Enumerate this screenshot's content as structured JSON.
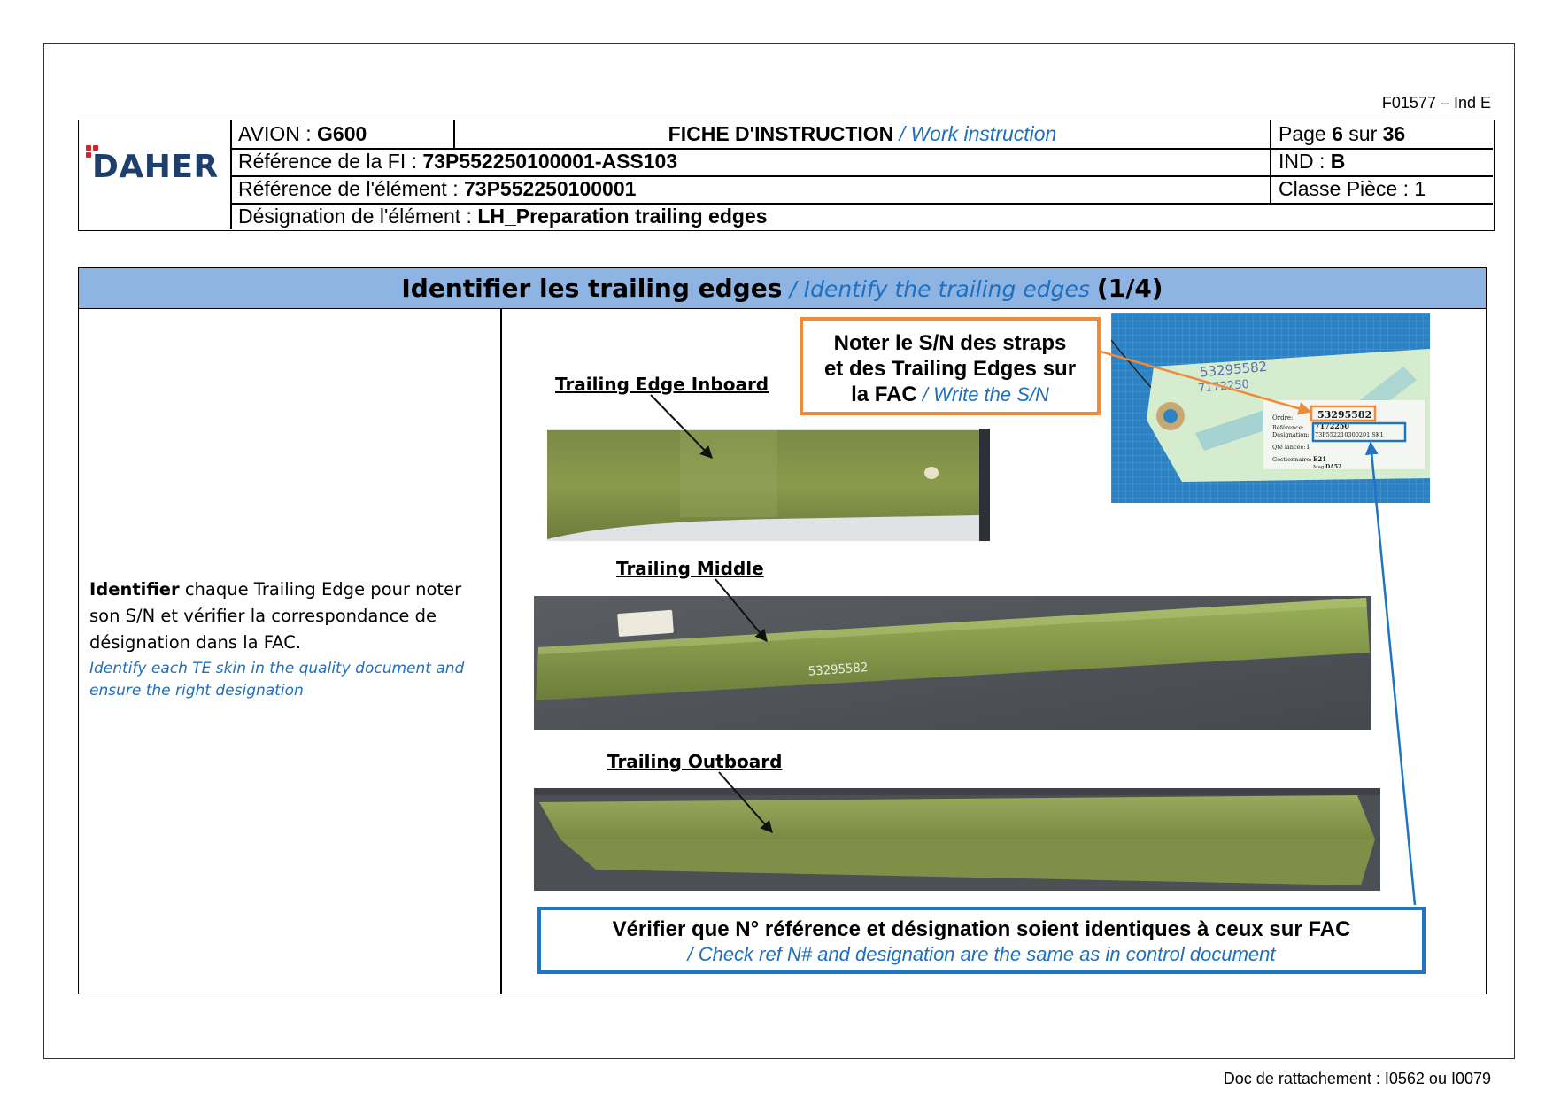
{
  "form_code": "F01577 – Ind E",
  "header": {
    "logo_text": "DAHER",
    "avion_label": "AVION : ",
    "avion_value": "G600",
    "title_fr": "FICHE D'INSTRUCTION",
    "title_en": " / Work instruction",
    "page_label": "Page ",
    "page_num": "6",
    "page_sur": " sur ",
    "page_total": "36",
    "ref_fi_label": "Référence de la FI : ",
    "ref_fi_value": "73P552250100001-ASS103",
    "ind_label": "IND : ",
    "ind_value": "B",
    "ref_elem_label": "Référence de l'élément : ",
    "ref_elem_value": "73P552250100001",
    "classe_label": "Classe Pièce : 1",
    "desig_label": "Désignation de l'élément : ",
    "desig_value": "LH_Preparation trailing edges"
  },
  "section": {
    "title_fr": "Identifier les trailing edges",
    "title_en": " / Identify the trailing edges ",
    "title_step": "(1/4)",
    "instruction_bold": "Identifier",
    "instruction_text": " chaque Trailing Edge pour noter son S/N et vérifier la correspondance de désignation dans la FAC.",
    "instruction_en": "Identify each TE skin in the quality document and ensure the right designation"
  },
  "photos": {
    "inboard_caption": "Trailing Edge Inboard",
    "middle_caption": "Trailing Middle",
    "outboard_caption": "Trailing Outboard",
    "tag_handwritten_1": "53295582",
    "tag_handwritten_2": "7172250",
    "tag_ordre_label": "Ordre:",
    "tag_ordre_value": "53295582",
    "tag_reference_label": "Référence:",
    "tag_reference_value": "7172250",
    "tag_designation_label": "Désignation:",
    "tag_designation_value": "73P552210300201 SK1",
    "tag_qte_label": "Qté lancée:",
    "tag_qte_value": "1",
    "tag_gest_label": "Gestionnaire:",
    "tag_gest_value": "E21",
    "tag_mag_label": "Mag:",
    "tag_mag_value": "DA52",
    "middle_marking": "53295582"
  },
  "callouts": {
    "orange_line1": "Noter le S/N des straps",
    "orange_line2": "et des Trailing Edges sur",
    "orange_line3": "la FAC",
    "orange_en": " / Write the S/N",
    "blue_fr": "Vérifier que N° référence et désignation soient identiques à ceux sur FAC",
    "blue_en": "/ Check ref N# and designation are the same as in control document"
  },
  "footer": "Doc de rattachement : I0562 ou I0079",
  "colors": {
    "title_band": "#8db4e2",
    "accent_blue": "#1f6fbf",
    "callout_orange": "#ed8b3a",
    "callout_blue": "#1f74c3",
    "brand_red": "#d6232a",
    "brand_navy": "#1c3f6e"
  }
}
